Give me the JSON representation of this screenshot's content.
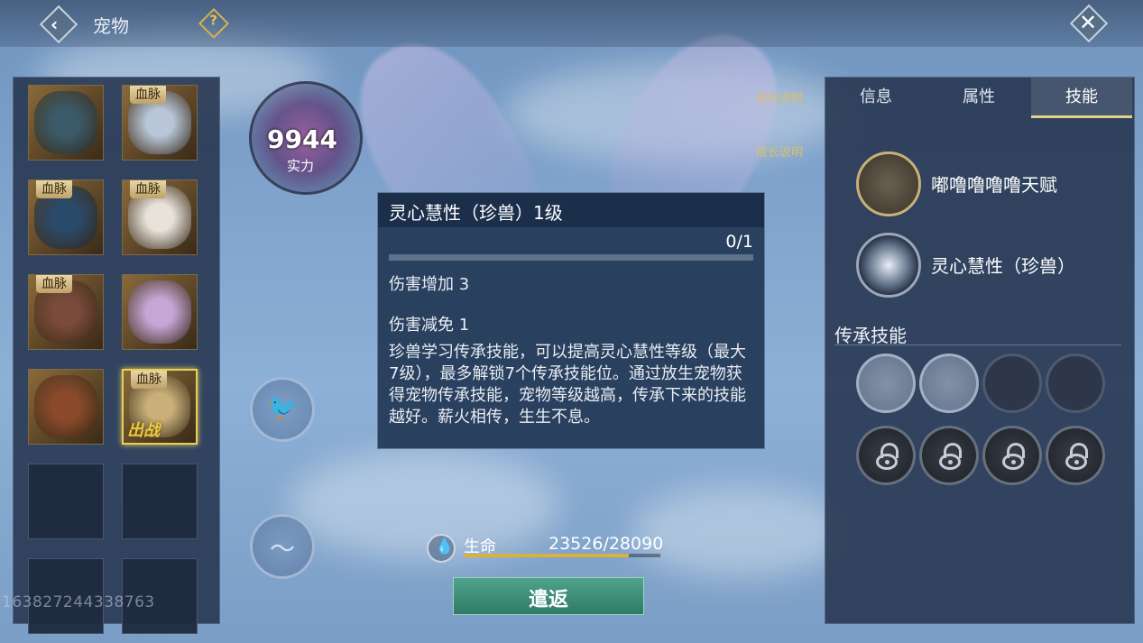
{
  "header": {
    "title": "宠物",
    "help_glyph": "?"
  },
  "pets": [
    {
      "badge": "",
      "art": "#3a5a6a",
      "deployed": false,
      "selected": false
    },
    {
      "badge": "血脉",
      "art": "#b8c6d8",
      "deployed": false,
      "selected": false
    },
    {
      "badge": "血脉",
      "art": "#2a4a6a",
      "deployed": false,
      "selected": false
    },
    {
      "badge": "血脉",
      "art": "#e8e2da",
      "deployed": false,
      "selected": false
    },
    {
      "badge": "血脉",
      "art": "#7a4a3a",
      "deployed": false,
      "selected": false
    },
    {
      "badge": "",
      "art": "#c7a6d6",
      "deployed": false,
      "selected": false
    },
    {
      "badge": "",
      "art": "#8a4a2a",
      "deployed": false,
      "selected": false
    },
    {
      "badge": "血脉",
      "art": "#c9b07a",
      "deployed": true,
      "deploy_label": "出战",
      "selected": true
    }
  ],
  "watermark": "163827244338763",
  "power": {
    "value": "9944",
    "label": "实力"
  },
  "side_links": {
    "evolve": "进化说明",
    "growth": "成长说明"
  },
  "tooltip": {
    "title": "灵心慧性（珍兽）1级",
    "progress": "0/1",
    "progress_fraction": 0,
    "line1": "伤害增加 3",
    "line2": "伤害减免 1",
    "description": "珍兽学习传承技能，可以提高灵心慧性等级（最大7级），最多解锁7个传承技能位。通过放生宠物获得宠物传承技能，宠物等级越高，传承下来的技能越好。薪火相传，生生不息。"
  },
  "hp": {
    "label": "生命",
    "value": "23526/28090",
    "fraction": 0.8375,
    "icon": "drop-icon"
  },
  "dismiss_label": "遣返",
  "tabs": [
    {
      "label": "信息",
      "active": false
    },
    {
      "label": "属性",
      "active": false
    },
    {
      "label": "技能",
      "active": true
    }
  ],
  "talents": [
    {
      "name": "嘟噜噜噜噜天赋",
      "icon": "ram-head-icon"
    },
    {
      "name": "灵心慧性（珍兽）",
      "icon": "crescent-moon-icon"
    }
  ],
  "inherit_title": "传承技能",
  "inherit_slots": [
    "learned",
    "learned",
    "empty",
    "empty",
    "locked",
    "locked",
    "locked",
    "locked"
  ],
  "colors": {
    "accent_gold": "#e6cf5a",
    "button_green": "#3e8e76",
    "panel": "#26344e"
  }
}
